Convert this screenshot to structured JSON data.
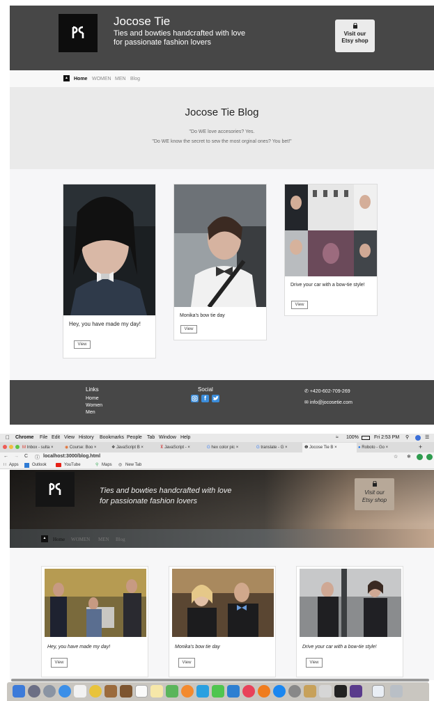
{
  "site": {
    "brand": "Jocose Tie",
    "tagline_line1": "Ties and bowties handcrafted with love",
    "tagline_line2": "for passionate fashion lovers",
    "logo_mark": "♛",
    "etsy_line1": "Visit our",
    "etsy_line2": "Etsy shop"
  },
  "nav": {
    "items": [
      "Home",
      "WOMEN",
      "MEN",
      "Blog"
    ]
  },
  "hero": {
    "title": "Jocose Tie Blog",
    "quote1": "\"Do WE love accesories? Yes.",
    "quote2": "\"Do WE know the secret to sew the most orginal ones? You bet!\""
  },
  "cards": [
    {
      "caption": "Hey, you have made my day!",
      "button": "View"
    },
    {
      "caption": "Monika's bow tie day",
      "button": "View"
    },
    {
      "caption": "Drive your car with a bow-tie style!",
      "button": "View"
    }
  ],
  "footer": {
    "links_title": "Links",
    "links": [
      "Home",
      "Women",
      "Men"
    ],
    "social_title": "Social",
    "phone": "+420-602-709-269",
    "email": "info@jocosetie.com"
  },
  "mac": {
    "menu": [
      "Chrome",
      "File",
      "Edit",
      "View",
      "History",
      "Bookmarks",
      "People",
      "Tab",
      "Window",
      "Help"
    ],
    "battery": "100%",
    "clock": "Fri 2:53 PM"
  },
  "browser": {
    "tabs": [
      "Inbox - sulta",
      "Course: Boo",
      "JavaScript B",
      "JavaScript -",
      "hex color pic",
      "translate - G",
      "Jocose Tie B",
      "Roboto - Go"
    ],
    "url": "localhost:3000/blog.html",
    "bookmarks": [
      "Apps",
      "Outlook",
      "YouTube",
      "Maps",
      "New Tab"
    ]
  },
  "colors": {
    "header_bg": "#474747",
    "hero_bg": "#eaeaea",
    "social_blue": "#3b8ddb"
  }
}
